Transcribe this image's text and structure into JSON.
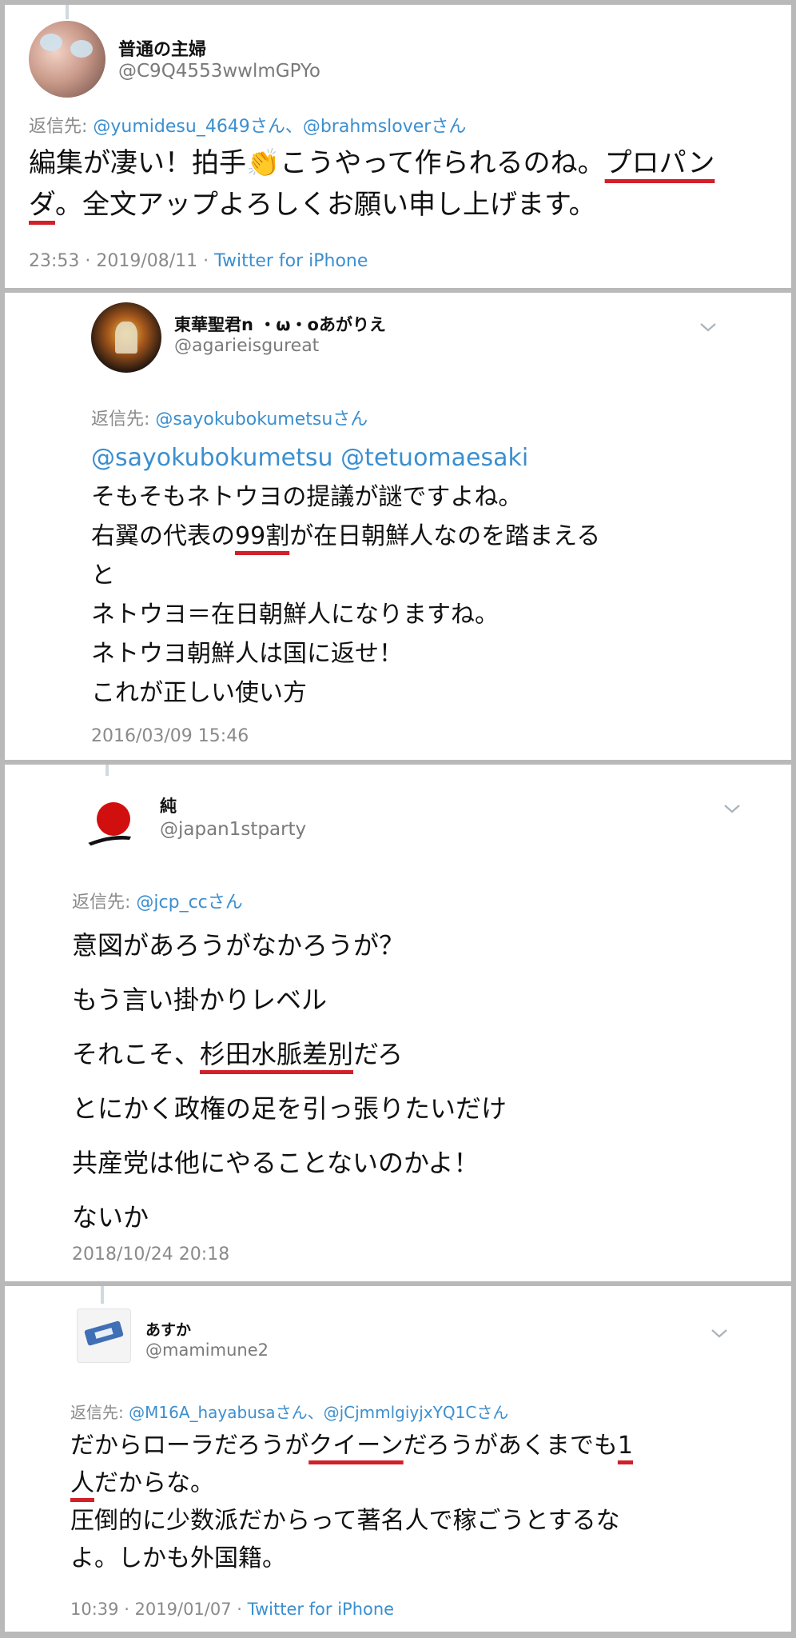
{
  "tweets": [
    {
      "name": "普通の主婦",
      "handle": "@C9Q4553wwlmGPYo",
      "reply_prefix": "返信先: ",
      "reply_to": [
        {
          "handle": "@yumidesu_4649",
          "suffix": "さん"
        },
        {
          "sep": "、"
        },
        {
          "handle": "@brahmslover",
          "suffix": "さん"
        }
      ],
      "body": {
        "l1a": "編集が凄い！拍手",
        "emoji": "👏",
        "l1b": "こうやって作られるのね。",
        "l1u": "プロパン",
        "l2u": "ダ",
        "l2b": "。全文アップよろしくお願い申し上げます。"
      },
      "time": "23:53 · 2019/08/11 · ",
      "client": "Twitter for iPhone"
    },
    {
      "name": "東華聖君n ・ω・oあがりえ",
      "handle": "@agarieisgureat",
      "reply_prefix": "返信先: ",
      "reply_to_handle": "@sayokubokumetsu",
      "reply_to_suffix": "さん",
      "mentions": "@sayokubokumetsu @tetuomaesaki",
      "lines": [
        "そもそもネトウヨの提議が謎ですよね。",
        "右翼の代表の",
        "99割",
        "が在日朝鮮人なのを踏まえる",
        "と",
        "ネトウヨ＝在日朝鮮人になりますね。",
        "ネトウヨ朝鮮人は国に返せ！",
        "これが正しい使い方"
      ],
      "time": "2016/03/09 15:46"
    },
    {
      "name": "純",
      "handle": "@japan1stparty",
      "reply_prefix": "返信先: ",
      "reply_to_handle": "@jcp_cc",
      "reply_to_suffix": "さん",
      "lines": [
        "意図があろうがなかろうが？",
        "もう言い掛かりレベル",
        "それこそ、",
        "杉田水脈差別",
        "だろ",
        "とにかく政権の足を引っ張りたいだけ",
        "共産党は他にやることないのかよ！",
        "ないか"
      ],
      "time": "2018/10/24 20:18"
    },
    {
      "name": "あすか",
      "handle": "@mamimune2",
      "reply_prefix": "返信先: ",
      "reply_to_a": "@M16A_hayabusa",
      "reply_to_a_suffix": "さん、",
      "reply_to_b": "@jCjmmlgiyjxYQ1C",
      "reply_to_b_suffix": "さん",
      "body": {
        "l1a": "だからローラだろうが",
        "l1u": "クイーン",
        "l1b": "だろうがあくまでも",
        "l1u2": "1",
        "l2u": "人",
        "l2b": "だからな。",
        "l3": "圧倒的に少数派だからって著名人で稼ごうとするな",
        "l4": "よ。しかも外国籍。"
      },
      "time": "10:39 · 2019/01/07 · ",
      "client": "Twitter for iPhone"
    }
  ],
  "icons": {
    "chevron": "chevron-down-icon",
    "clap": "clapping-hands-emoji"
  }
}
